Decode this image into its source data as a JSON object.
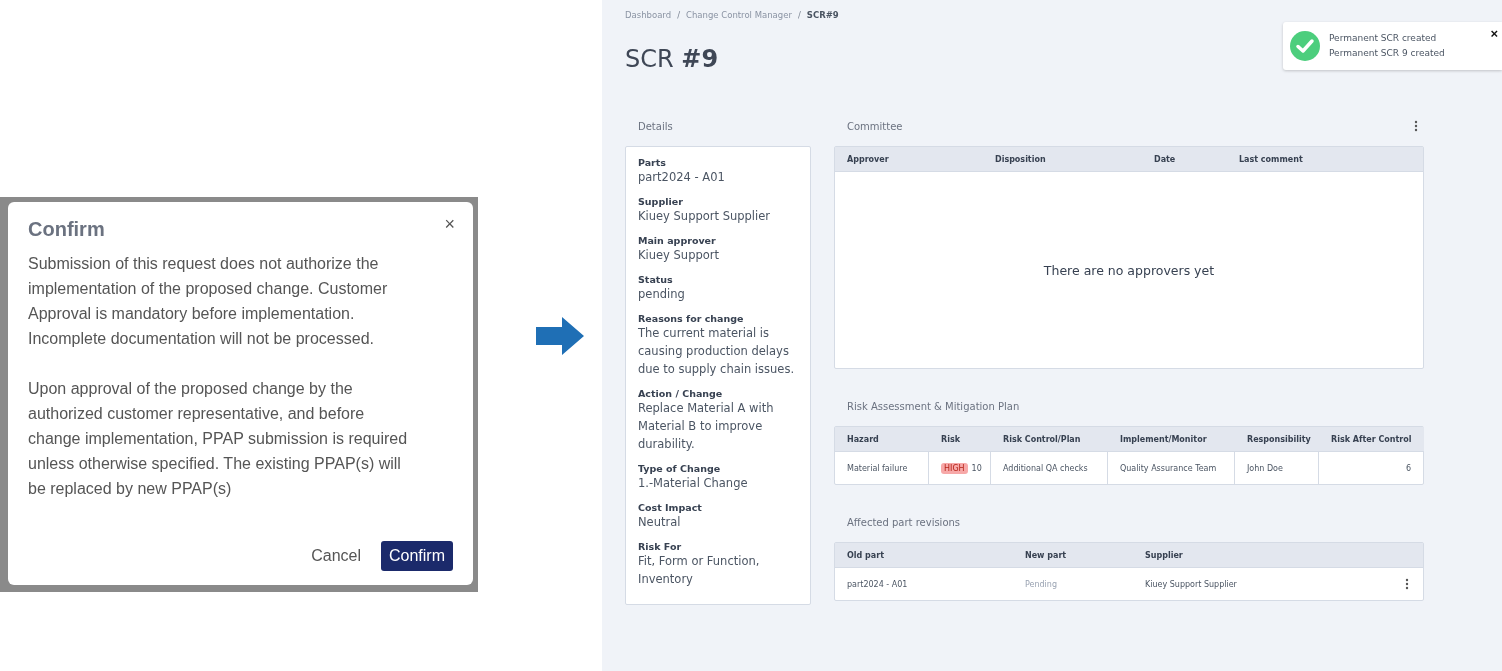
{
  "dialog": {
    "title": "Confirm",
    "paragraphs": [
      "Submission of this request does not authorize the implementation of the proposed change. Customer Approval is mandatory before implementation. Incomplete documentation will not be processed.",
      "Upon approval of the proposed change by the authorized customer representative, and before change implementation, PPAP submission is required unless otherwise specified. The existing PPAP(s) will be replaced by new PPAP(s)"
    ],
    "close": "×",
    "buttons": [
      {
        "label": "Cancel",
        "kind": "text"
      },
      {
        "label": "Confirm",
        "kind": "primary"
      }
    ]
  },
  "breadcrumb_separator": "/",
  "breadcrumb": [
    {
      "label": "Dashboard",
      "current": false
    },
    {
      "label": "Change Control Manager",
      "current": false
    },
    {
      "label": "SCR#9",
      "current": true
    }
  ],
  "page_title": "SCR **#9**",
  "toast": {
    "title": "Permanent SCR created",
    "message": "Permanent SCR 9 created",
    "close": "×"
  },
  "details": {
    "heading": "Details",
    "fields": [
      {
        "label": "Parts",
        "value": "part2024 - A01"
      },
      {
        "label": "Supplier",
        "value": "Kiuey Support Supplier"
      },
      {
        "label": "Main approver",
        "value": "Kiuey Support"
      },
      {
        "label": "Status",
        "value": "pending"
      },
      {
        "label": "Reasons for change",
        "value": "The current material is causing production delays due to supply chain issues."
      },
      {
        "label": "Action / Change",
        "value": "Replace Material A with Material B to improve durability."
      },
      {
        "label": "Type of Change",
        "value": "1.-Material Change"
      },
      {
        "label": "Cost Impact",
        "value": "Neutral"
      },
      {
        "label": "Risk For",
        "value": "Fit, Form or Function, Inventory"
      }
    ]
  },
  "committee": {
    "heading": "Committee",
    "columns": [
      "Approver",
      "Disposition",
      "Date",
      "Last comment"
    ],
    "empty_text": "There are no approvers yet"
  },
  "risk": {
    "heading": "Risk Assessment & Mitigation Plan",
    "columns": [
      "Hazard",
      "Risk",
      "Risk Control/Plan",
      "Implement/Monitor",
      "Responsibility",
      "Risk After Control"
    ],
    "rows": [
      {
        "hazard": "Material failure",
        "risk_badge": "HIGH",
        "risk_score": "10",
        "control": "Additional QA checks",
        "implement": "Quality Assurance Team",
        "responsibility": "John Doe",
        "risk_after": "6"
      }
    ]
  },
  "affected": {
    "heading": "Affected part revisions",
    "columns": [
      "Old part",
      "New part",
      "Supplier"
    ],
    "rows": [
      {
        "old_part": "part2024 - A01",
        "new_part": "Pending",
        "new_part_pending": true,
        "supplier": "Kiuey Support Supplier"
      }
    ]
  }
}
